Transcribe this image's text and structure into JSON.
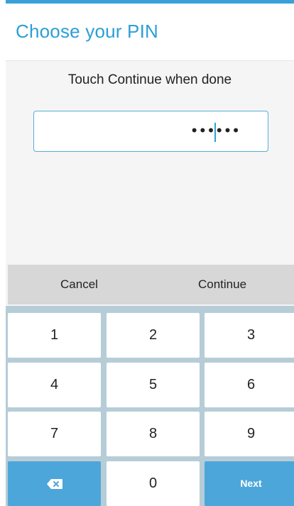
{
  "header": {
    "title": "Choose your PIN"
  },
  "instruction": "Touch Continue when done",
  "pin_field": {
    "masked_value": "••••••"
  },
  "actions": {
    "cancel": "Cancel",
    "continue": "Continue"
  },
  "keypad": {
    "rows": [
      [
        "1",
        "2",
        "3"
      ],
      [
        "4",
        "5",
        "6"
      ],
      [
        "7",
        "8",
        "9"
      ]
    ],
    "zero": "0",
    "next": "Next",
    "backspace_icon": "backspace-icon"
  },
  "colors": {
    "accent": "#2b9fd6",
    "key_blue": "#4da6d9",
    "keypad_bg": "#b6cdd8"
  }
}
